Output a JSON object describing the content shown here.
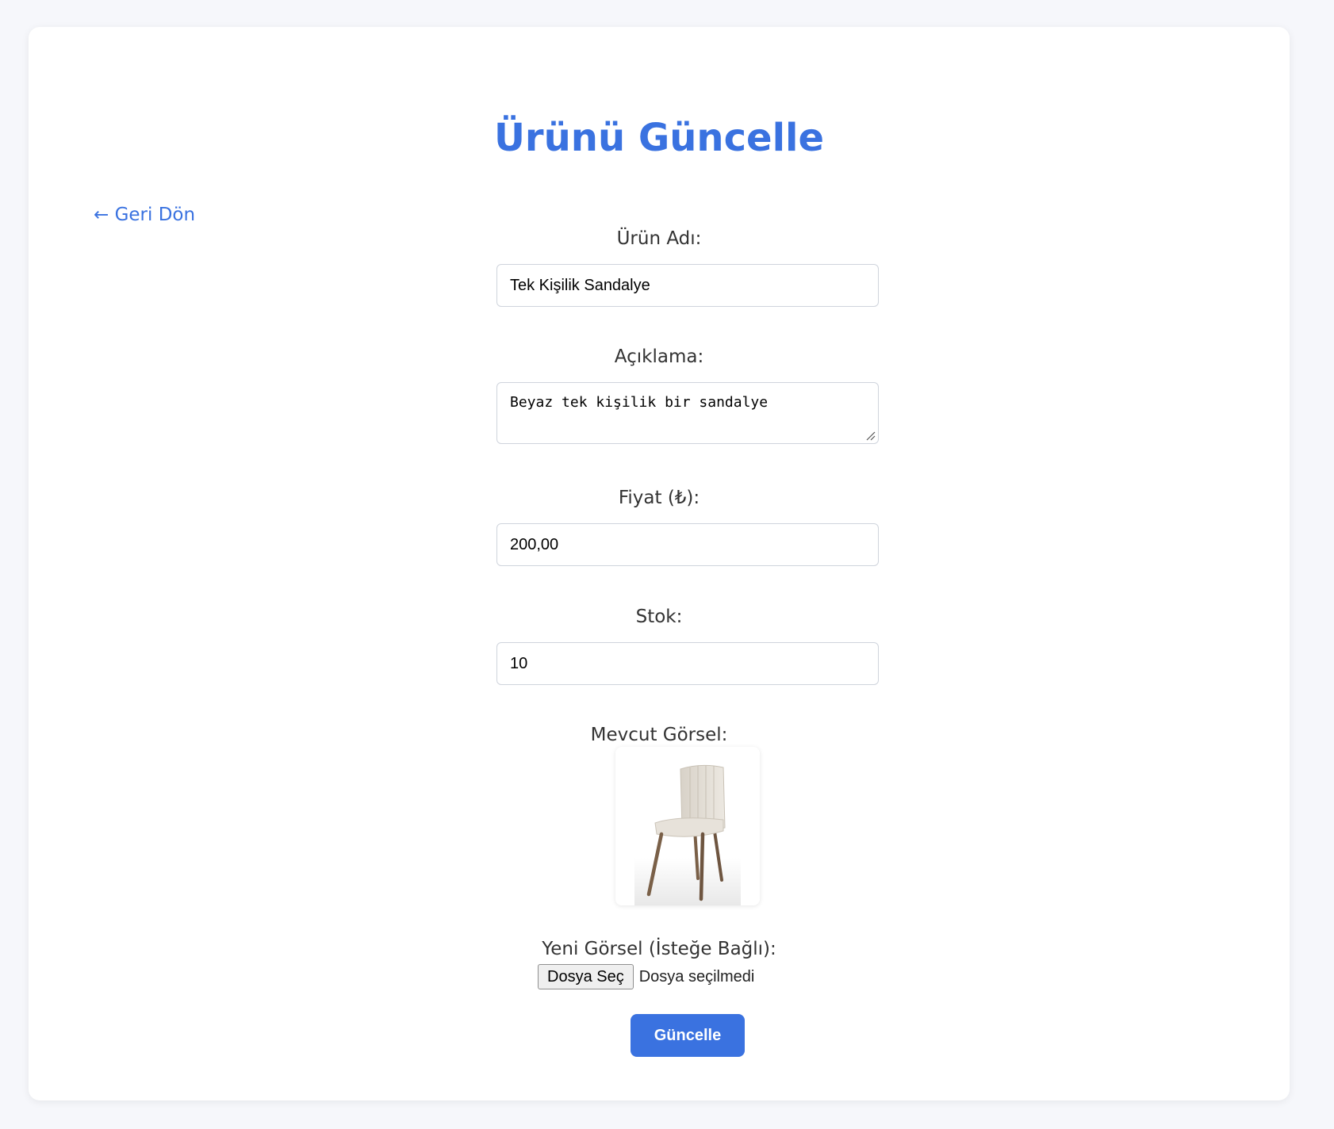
{
  "page": {
    "title": "Ürünü Güncelle",
    "back_link": "← Geri Dön"
  },
  "form": {
    "name": {
      "label": "Ürün Adı:",
      "value": "Tek Kişilik Sandalye"
    },
    "description": {
      "label": "Açıklama:",
      "value": "Beyaz tek kişilik bir sandalye"
    },
    "price": {
      "label": "Fiyat (₺):",
      "value": "200,00"
    },
    "stock": {
      "label": "Stok:",
      "value": "10"
    },
    "current_image": {
      "label": "Mevcut Görsel:",
      "image": "chair-photo"
    },
    "new_image": {
      "label": "Yeni Görsel (İsteğe Bağlı):",
      "button": "Dosya Seç",
      "status": "Dosya seçilmedi"
    },
    "submit": "Güncelle"
  },
  "colors": {
    "accent": "#3a72e0",
    "background": "#f6f7fb",
    "card": "#ffffff"
  }
}
